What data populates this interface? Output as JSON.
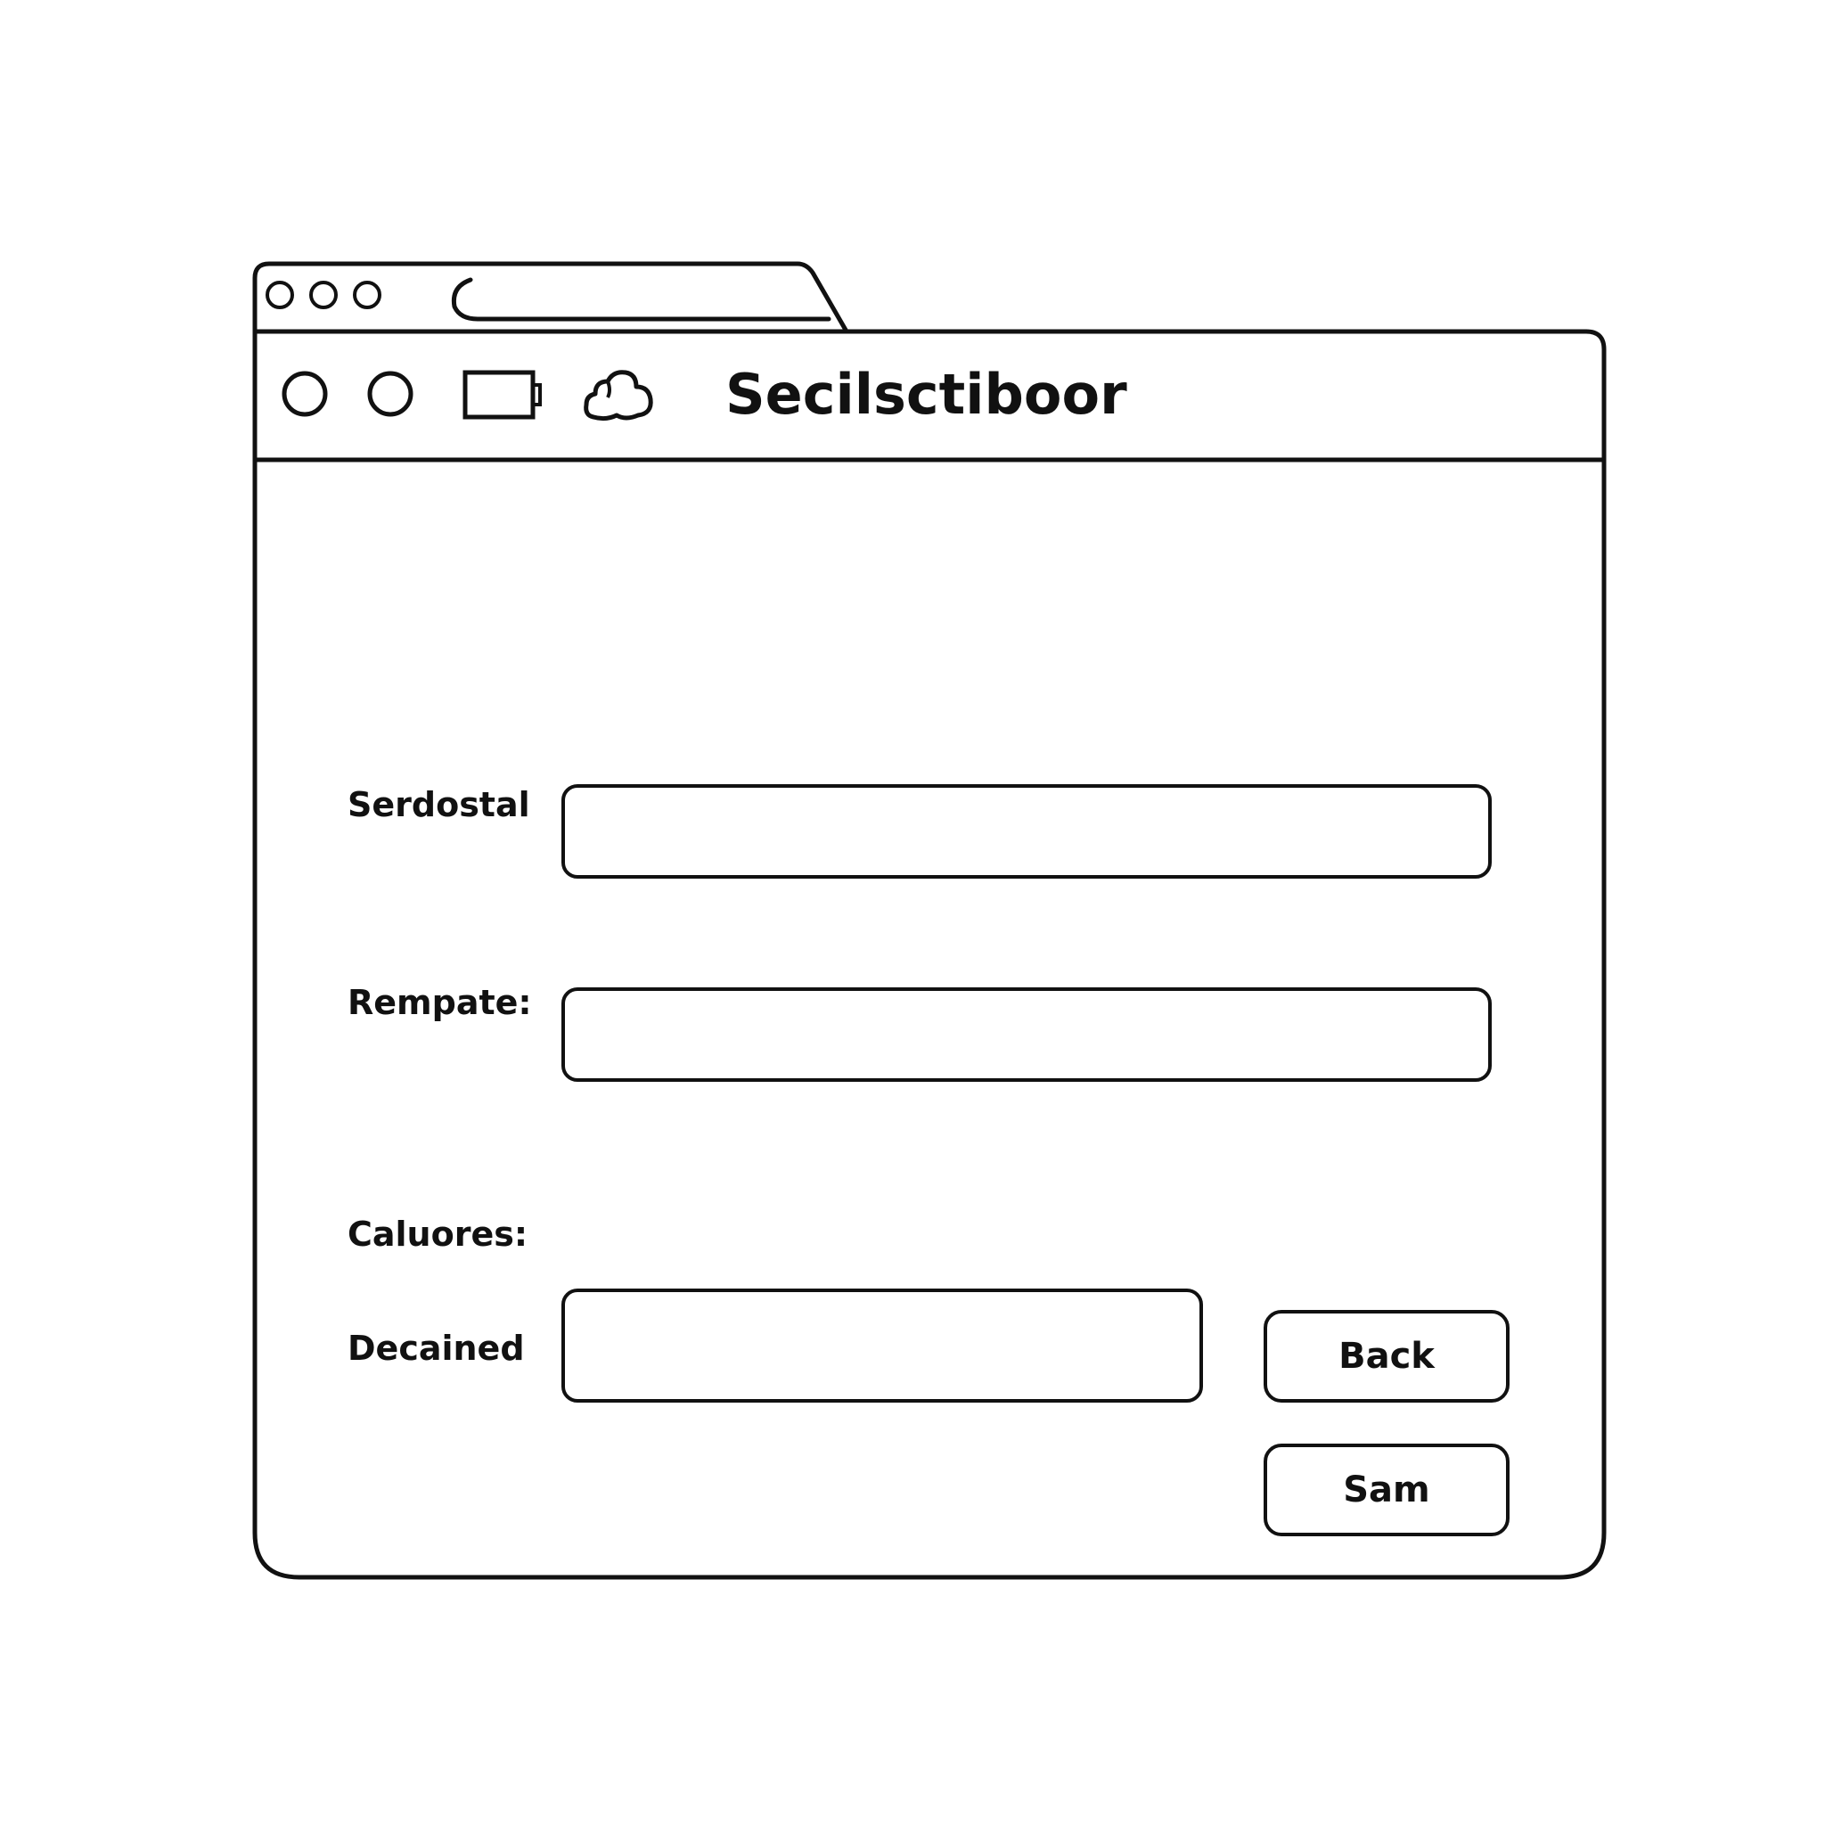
{
  "window": {
    "title": "Secilsctiboor"
  },
  "toolbar": {
    "icons": [
      "circle-icon",
      "circle-icon",
      "battery-icon",
      "cloud-icon"
    ]
  },
  "form": {
    "fields": [
      {
        "label": "Serdostal",
        "value": "",
        "placeholder": ""
      },
      {
        "label": "Rempate:",
        "value": "",
        "placeholder": ""
      },
      {
        "label": "Decained",
        "value": "",
        "placeholder": ""
      }
    ],
    "section_label": "Caluores:"
  },
  "buttons": {
    "back_label": "Back",
    "sam_label": "Sam"
  },
  "colors": {
    "stroke": "#111111",
    "background": "#ffffff"
  }
}
